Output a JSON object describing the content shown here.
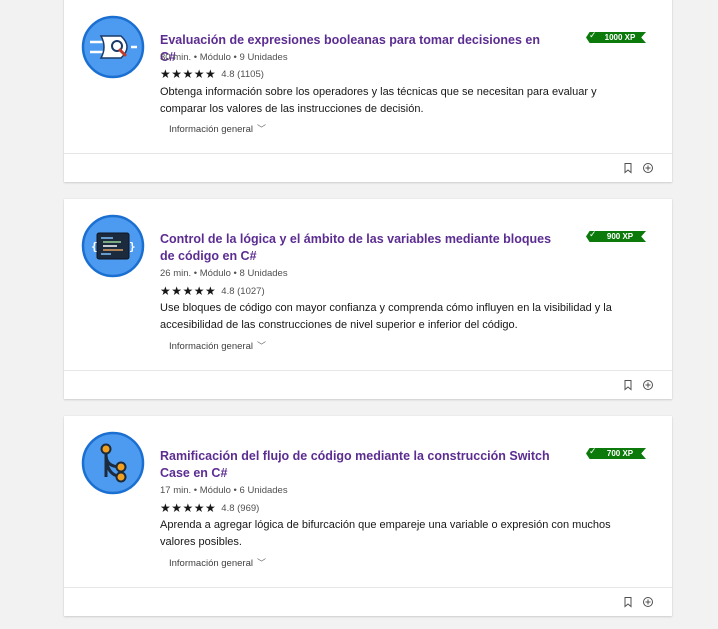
{
  "cards": [
    {
      "title": "Evaluación de expresiones booleanas para tomar decisiones en C#",
      "xp": "1000 XP",
      "meta": "30 min. • Módulo • 9 Unidades",
      "stars": "★★★★★",
      "rating": "4.8 (1105)",
      "description": "Obtenga información sobre los operadores y las técnicas que se necesitan para evaluar y comparar los valores de las instrucciones de decisión.",
      "info": "Información general",
      "icon": "logic-gate-icon"
    },
    {
      "title": "Control de la lógica y el ámbito de las variables mediante bloques de código en C#",
      "xp": "900 XP",
      "meta": "26 min. • Módulo • 8 Unidades",
      "stars": "★★★★★",
      "rating": "4.8 (1027)",
      "description": "Use bloques de código con mayor confianza y comprenda cómo influyen en la visibilidad y la accesibilidad de las construcciones de nivel superior e inferior del código.",
      "info": "Información general",
      "icon": "code-block-icon"
    },
    {
      "title": "Ramificación del flujo de código mediante la construcción Switch Case en C#",
      "xp": "700 XP",
      "meta": "17 min. • Módulo • 6 Unidades",
      "stars": "★★★★★",
      "rating": "4.8 (969)",
      "description": "Aprenda a agregar lógica de bifurcación que empareje una variable o expresión con muchos valores posibles.",
      "info": "Información general",
      "icon": "branch-icon"
    }
  ],
  "colors": {
    "title": "#5c2d91",
    "xp_badge": "#0b7a0b",
    "icon_blue": "#4d9bf0"
  }
}
